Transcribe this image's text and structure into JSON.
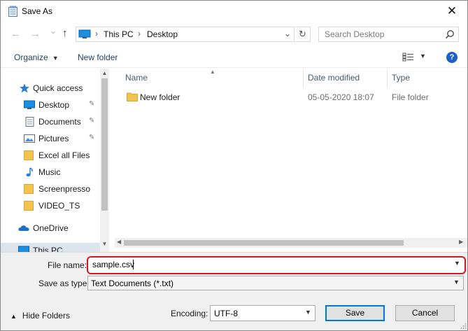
{
  "window": {
    "title": "Save As",
    "close_glyph": "✕"
  },
  "nav": {
    "back_glyph": "←",
    "forward_glyph": "→",
    "recent_glyph": "⌄",
    "up_glyph": "↑",
    "address": {
      "segments": [
        "This PC",
        "Desktop"
      ],
      "separator": "›",
      "dropdown_glyph": "⌄",
      "refresh_glyph": "↻"
    },
    "search": {
      "placeholder": "Search Desktop"
    }
  },
  "toolbar": {
    "organize_label": "Organize",
    "new_folder_label": "New folder",
    "help_glyph": "?"
  },
  "sidebar": {
    "items": [
      {
        "label": "Quick access",
        "icon": "star-icon",
        "pinned": false
      },
      {
        "label": "Desktop",
        "icon": "desktop-icon",
        "pinned": true
      },
      {
        "label": "Documents",
        "icon": "documents-icon",
        "pinned": true
      },
      {
        "label": "Pictures",
        "icon": "pictures-icon",
        "pinned": true
      },
      {
        "label": "Excel all Files",
        "icon": "folder-icon",
        "pinned": false
      },
      {
        "label": "Music",
        "icon": "music-icon",
        "pinned": false
      },
      {
        "label": "Screenpresso",
        "icon": "folder-icon",
        "pinned": false
      },
      {
        "label": "VIDEO_TS",
        "icon": "folder-icon",
        "pinned": false
      },
      {
        "label": "OneDrive",
        "icon": "cloud-icon",
        "pinned": false
      },
      {
        "label": "This PC",
        "icon": "pc-icon",
        "pinned": false
      }
    ],
    "pin_glyph": "📌"
  },
  "files": {
    "columns": [
      "Name",
      "Date modified",
      "Type"
    ],
    "rows": [
      {
        "name": "New folder",
        "date_modified": "05-05-2020 18:07",
        "type": "File folder"
      }
    ]
  },
  "form": {
    "file_name_label": "File name:",
    "file_name_value": "sample.csv",
    "save_as_type_label": "Save as type:",
    "save_as_type_value": "Text Documents (*.txt)",
    "encoding_label": "Encoding:",
    "encoding_value": "UTF-8",
    "dropdown_glyph": "⌄"
  },
  "footer": {
    "hide_folders_label": "Hide Folders",
    "hide_glyph": "⌃",
    "save_label": "Save",
    "cancel_label": "Cancel"
  },
  "colors": {
    "highlight_border": "#d6151f",
    "primary_button_border": "#0078d7",
    "help_icon": "#1f60c4",
    "folder": "#f4c24f"
  }
}
